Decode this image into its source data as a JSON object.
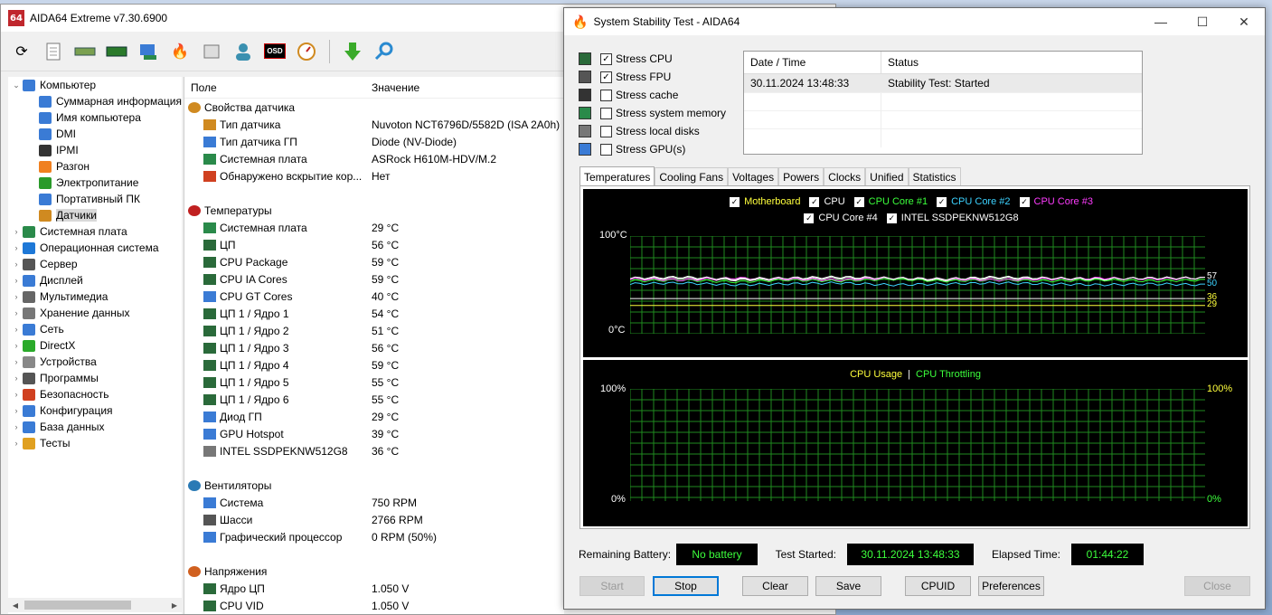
{
  "main_window": {
    "title": "AIDA64 Extreme v7.30.6900",
    "tree": [
      {
        "label": "Компьютер",
        "level": 0,
        "arrow": "⌄",
        "color": "#3a7bd5"
      },
      {
        "label": "Суммарная информация",
        "level": 1,
        "arrow": "",
        "color": "#3a7bd5"
      },
      {
        "label": "Имя компьютера",
        "level": 1,
        "arrow": "",
        "color": "#3a7bd5"
      },
      {
        "label": "DMI",
        "level": 1,
        "arrow": "",
        "color": "#3a7bd5"
      },
      {
        "label": "IPMI",
        "level": 1,
        "arrow": "",
        "color": "#333333"
      },
      {
        "label": "Разгон",
        "level": 1,
        "arrow": "",
        "color": "#f08020"
      },
      {
        "label": "Электропитание",
        "level": 1,
        "arrow": "",
        "color": "#2a9a2a"
      },
      {
        "label": "Портативный ПК",
        "level": 1,
        "arrow": "",
        "color": "#3a7bd5"
      },
      {
        "label": "Датчики",
        "level": 1,
        "arrow": "",
        "color": "#d08a20",
        "selected": true
      },
      {
        "label": "Системная плата",
        "level": 0,
        "arrow": "›",
        "color": "#2a8a4a"
      },
      {
        "label": "Операционная система",
        "level": 0,
        "arrow": "›",
        "color": "#1e78d7"
      },
      {
        "label": "Сервер",
        "level": 0,
        "arrow": "›",
        "color": "#555555"
      },
      {
        "label": "Дисплей",
        "level": 0,
        "arrow": "›",
        "color": "#3a7bd5"
      },
      {
        "label": "Мультимедиа",
        "level": 0,
        "arrow": "›",
        "color": "#666666"
      },
      {
        "label": "Хранение данных",
        "level": 0,
        "arrow": "›",
        "color": "#777777"
      },
      {
        "label": "Сеть",
        "level": 0,
        "arrow": "›",
        "color": "#3a7bd5"
      },
      {
        "label": "DirectX",
        "level": 0,
        "arrow": "›",
        "color": "#2aaa2a"
      },
      {
        "label": "Устройства",
        "level": 0,
        "arrow": "›",
        "color": "#888888"
      },
      {
        "label": "Программы",
        "level": 0,
        "arrow": "›",
        "color": "#555555"
      },
      {
        "label": "Безопасность",
        "level": 0,
        "arrow": "›",
        "color": "#d04020"
      },
      {
        "label": "Конфигурация",
        "level": 0,
        "arrow": "›",
        "color": "#3a7bd5"
      },
      {
        "label": "База данных",
        "level": 0,
        "arrow": "›",
        "color": "#3a7bd5"
      },
      {
        "label": "Тесты",
        "level": 0,
        "arrow": "›",
        "color": "#e0a020"
      }
    ],
    "list_headers": {
      "field": "Поле",
      "value": "Значение"
    },
    "sections": [
      {
        "title": "Свойства датчика",
        "icon_color": "#d08a20",
        "rows": [
          {
            "name": "Тип датчика",
            "value": "Nuvoton NCT6796D/5582D  (ISA 2A0h)",
            "icon_color": "#d08a20"
          },
          {
            "name": "Тип датчика ГП",
            "value": "Diode  (NV-Diode)",
            "icon_color": "#3a7bd5"
          },
          {
            "name": "Системная плата",
            "value": "ASRock H610M-HDV/M.2",
            "icon_color": "#2a8a4a"
          },
          {
            "name": "Обнаружено вскрытие кор...",
            "value": "Нет",
            "icon_color": "#d04020"
          }
        ]
      },
      {
        "title": "Температуры",
        "icon_color": "#c02020",
        "rows": [
          {
            "name": "Системная плата",
            "value": "29 °C",
            "icon_color": "#2a8a4a"
          },
          {
            "name": "ЦП",
            "value": "56 °C",
            "icon_color": "#2a6a3a"
          },
          {
            "name": "CPU Package",
            "value": "59 °C",
            "icon_color": "#2a6a3a"
          },
          {
            "name": "CPU IA Cores",
            "value": "59 °C",
            "icon_color": "#2a6a3a"
          },
          {
            "name": "CPU GT Cores",
            "value": "40 °C",
            "icon_color": "#3a7bd5"
          },
          {
            "name": "ЦП 1 / Ядро 1",
            "value": "54 °C",
            "icon_color": "#2a6a3a"
          },
          {
            "name": "ЦП 1 / Ядро 2",
            "value": "51 °C",
            "icon_color": "#2a6a3a"
          },
          {
            "name": "ЦП 1 / Ядро 3",
            "value": "56 °C",
            "icon_color": "#2a6a3a"
          },
          {
            "name": "ЦП 1 / Ядро 4",
            "value": "59 °C",
            "icon_color": "#2a6a3a"
          },
          {
            "name": "ЦП 1 / Ядро 5",
            "value": "55 °C",
            "icon_color": "#2a6a3a"
          },
          {
            "name": "ЦП 1 / Ядро 6",
            "value": "55 °C",
            "icon_color": "#2a6a3a"
          },
          {
            "name": "Диод ГП",
            "value": "29 °C",
            "icon_color": "#3a7bd5"
          },
          {
            "name": "GPU Hotspot",
            "value": "39 °C",
            "icon_color": "#3a7bd5"
          },
          {
            "name": "INTEL SSDPEKNW512G8",
            "value": "36 °C",
            "icon_color": "#777777"
          }
        ]
      },
      {
        "title": "Вентиляторы",
        "icon_color": "#2a7ab5",
        "rows": [
          {
            "name": "Система",
            "value": "750 RPM",
            "icon_color": "#3a7bd5"
          },
          {
            "name": "Шасси",
            "value": "2766 RPM",
            "icon_color": "#555555"
          },
          {
            "name": "Графический процессор",
            "value": "0 RPM  (50%)",
            "icon_color": "#3a7bd5"
          }
        ]
      },
      {
        "title": "Напряжения",
        "icon_color": "#d06020",
        "rows": [
          {
            "name": "Ядро ЦП",
            "value": "1.050 V",
            "icon_color": "#2a6a3a"
          },
          {
            "name": "CPU VID",
            "value": "1.050 V",
            "icon_color": "#2a6a3a"
          }
        ]
      }
    ]
  },
  "stability": {
    "title": "System Stability Test - AIDA64",
    "window_buttons": [
      "—",
      "☐",
      "✕"
    ],
    "stress": [
      {
        "label": "Stress CPU",
        "checked": true,
        "icon_color": "#2a6a3a"
      },
      {
        "label": "Stress FPU",
        "checked": true,
        "icon_color": "#555555"
      },
      {
        "label": "Stress cache",
        "checked": false,
        "icon_color": "#333333"
      },
      {
        "label": "Stress system memory",
        "checked": false,
        "icon_color": "#2a8a4a"
      },
      {
        "label": "Stress local disks",
        "checked": false,
        "icon_color": "#777777"
      },
      {
        "label": "Stress GPU(s)",
        "checked": false,
        "icon_color": "#3a7bd5"
      }
    ],
    "status_headers": {
      "date": "Date / Time",
      "status": "Status"
    },
    "status_rows": [
      {
        "date": "30.11.2024 13:48:33",
        "status": "Stability Test: Started"
      }
    ],
    "tabs": [
      "Temperatures",
      "Cooling Fans",
      "Voltages",
      "Powers",
      "Clocks",
      "Unified",
      "Statistics"
    ],
    "active_tab": "Temperatures",
    "temp_legend": [
      {
        "label": "Motherboard",
        "color": "#ffff3c"
      },
      {
        "label": "CPU",
        "color": "#ffffff"
      },
      {
        "label": "CPU Core #1",
        "color": "#3cff3c"
      },
      {
        "label": "CPU Core #2",
        "color": "#3cd2ff"
      },
      {
        "label": "CPU Core #3",
        "color": "#ff3cff"
      },
      {
        "label": "CPU Core #4",
        "color": "#ffffff"
      },
      {
        "label": "INTEL SSDPEKNW512G8",
        "color": "#ffffff"
      }
    ],
    "temp_axis": {
      "top": "100°C",
      "bottom": "0°C"
    },
    "temp_right_labels": [
      {
        "text": "57",
        "color": "#ffffff",
        "value": 57
      },
      {
        "text": "50",
        "color": "#3cd2ff",
        "value": 50
      },
      {
        "text": "36",
        "color": "#ffff3c",
        "value": 36
      },
      {
        "text": "29",
        "color": "#ffff3c",
        "value": 29
      }
    ],
    "usage_legend": {
      "a": "CPU Usage",
      "sep": "|",
      "b": "CPU Throttling",
      "a_color": "#ffff3c",
      "b_color": "#3cff3c"
    },
    "usage_axis": {
      "top_left": "100%",
      "bottom_left": "0%",
      "top_right": "100%",
      "bottom_right": "0%"
    },
    "footer": {
      "battery_label": "Remaining Battery:",
      "battery_value": "No battery",
      "started_label": "Test Started:",
      "started_value": "30.11.2024 13:48:33",
      "elapsed_label": "Elapsed Time:",
      "elapsed_value": "01:44:22"
    },
    "buttons": {
      "start": "Start",
      "stop": "Stop",
      "clear": "Clear",
      "save": "Save",
      "cpuid": "CPUID",
      "preferences": "Preferences",
      "close": "Close"
    }
  },
  "chart_data": [
    {
      "type": "line",
      "title": "",
      "ylim": [
        0,
        100
      ],
      "y_tick_labels": [
        "0°C",
        "100°C"
      ],
      "series": [
        {
          "name": "Motherboard",
          "values": [
            29,
            29,
            29,
            29,
            29,
            29,
            29,
            29,
            29,
            29,
            29,
            29
          ]
        },
        {
          "name": "CPU",
          "values": [
            56,
            57,
            55,
            56,
            57,
            56,
            55,
            57,
            56,
            56,
            57,
            57
          ]
        },
        {
          "name": "CPU Core #1",
          "values": [
            54,
            55,
            53,
            55,
            54,
            56,
            54,
            55,
            54,
            55,
            54,
            55
          ]
        },
        {
          "name": "CPU Core #2",
          "values": [
            51,
            52,
            50,
            51,
            52,
            50,
            51,
            52,
            51,
            50,
            51,
            50
          ]
        },
        {
          "name": "CPU Core #3",
          "values": [
            56,
            55,
            57,
            56,
            55,
            57,
            56,
            55,
            56,
            57,
            56,
            57
          ]
        },
        {
          "name": "CPU Core #4",
          "values": [
            57,
            58,
            56,
            57,
            58,
            57,
            56,
            58,
            57,
            56,
            57,
            57
          ]
        },
        {
          "name": "INTEL SSDPEKNW512G8",
          "values": [
            36,
            36,
            36,
            36,
            36,
            36,
            36,
            36,
            36,
            36,
            36,
            36
          ]
        }
      ]
    },
    {
      "type": "line",
      "title": "",
      "ylim": [
        0,
        100
      ],
      "y_tick_labels": [
        "0%",
        "100%"
      ],
      "series": [
        {
          "name": "CPU Usage",
          "values": []
        },
        {
          "name": "CPU Throttling",
          "values": []
        }
      ]
    }
  ]
}
